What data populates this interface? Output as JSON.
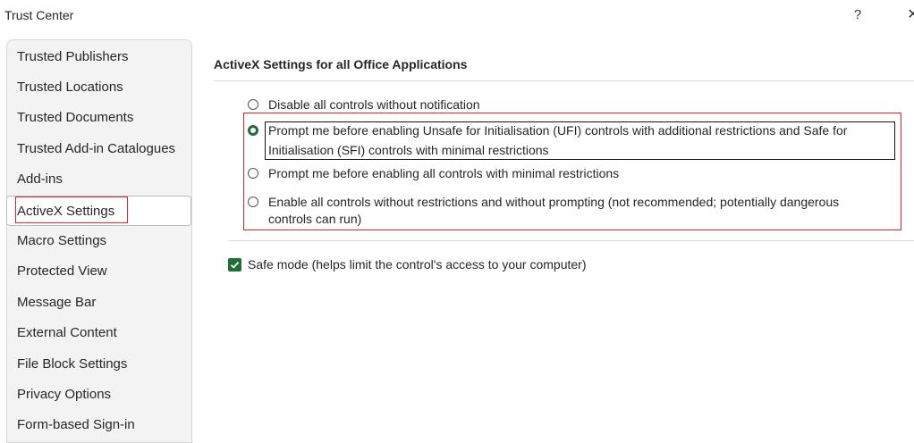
{
  "window": {
    "title": "Trust Center",
    "help_label": "?",
    "close_label": "✕"
  },
  "sidebar": {
    "items": [
      {
        "label": "Trusted Publishers"
      },
      {
        "label": "Trusted Locations"
      },
      {
        "label": "Trusted Documents"
      },
      {
        "label": "Trusted Add-in Catalogues"
      },
      {
        "label": "Add-ins"
      },
      {
        "label": "ActiveX Settings",
        "active": true
      },
      {
        "label": "Macro Settings"
      },
      {
        "label": "Protected View"
      },
      {
        "label": "Message Bar"
      },
      {
        "label": "External Content"
      },
      {
        "label": "File Block Settings"
      },
      {
        "label": "Privacy Options"
      },
      {
        "label": "Form-based Sign-in"
      }
    ]
  },
  "main": {
    "section_title": "ActiveX Settings for all Office Applications",
    "options": [
      {
        "lines": [
          "Disable all controls without notification"
        ],
        "checked": false
      },
      {
        "lines": [
          "Prompt me before enabling Unsafe for Initialisation (UFI) controls with additional restrictions and Safe for",
          "Initialisation (SFI) controls with minimal restrictions"
        ],
        "checked": true
      },
      {
        "lines": [
          "Prompt me before enabling all controls with minimal restrictions"
        ],
        "checked": false
      },
      {
        "lines": [
          "Enable all controls without restrictions and without prompting (not recommended; potentially dangerous",
          "controls can run)"
        ],
        "checked": false
      }
    ],
    "safe_mode": {
      "label": "Safe mode (helps limit the control's access to your computer)",
      "checked": true
    }
  },
  "colors": {
    "accent": "#1e6e36",
    "highlight_red": "#e0262c"
  }
}
